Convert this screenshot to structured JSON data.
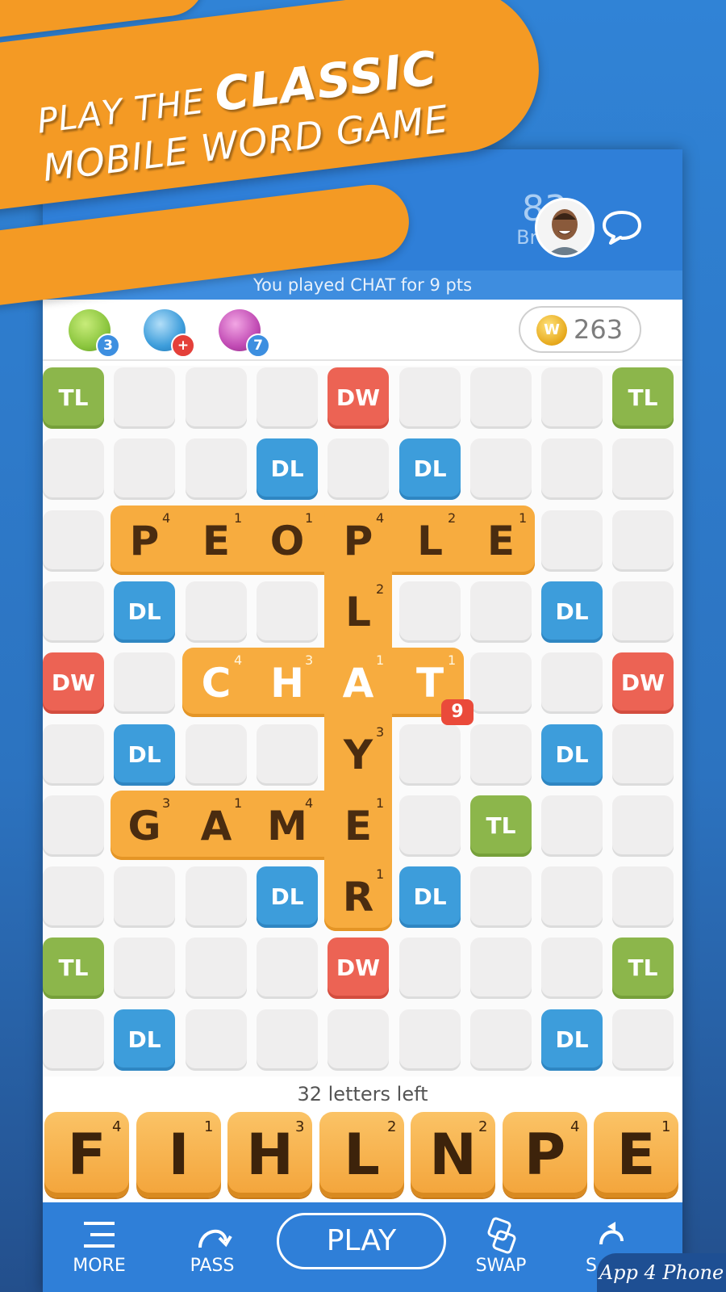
{
  "banner": {
    "line1_prefix": "PLAY THE",
    "line1_emphasis": "CLASSIC",
    "line2": "MOBILE WORD GAME"
  },
  "opponent": {
    "score": "83",
    "name": "Brian"
  },
  "status": "You played CHAT for 9 pts",
  "powerups": [
    {
      "icon": "swoosh-icon",
      "count": "3",
      "color": "#8cc63f",
      "badge_color": "#3d8fe0"
    },
    {
      "icon": "hindsight-icon",
      "count": "+",
      "color": "#3d9ddb",
      "badge_color": "#e4403a"
    },
    {
      "icon": "tile-swap-icon",
      "count": "7",
      "color": "#c14bb4",
      "badge_color": "#3d8fe0"
    }
  ],
  "coins": "263",
  "coin_symbol": "W",
  "board": {
    "bonus_cells": [
      {
        "r": 0,
        "c": 0,
        "type": "tl",
        "label": "TL"
      },
      {
        "r": 0,
        "c": 4,
        "type": "dw",
        "label": "DW"
      },
      {
        "r": 0,
        "c": 8,
        "type": "tl",
        "label": "TL"
      },
      {
        "r": 1,
        "c": 3,
        "type": "dl",
        "label": "DL"
      },
      {
        "r": 1,
        "c": 5,
        "type": "dl",
        "label": "DL"
      },
      {
        "r": 3,
        "c": 1,
        "type": "dl",
        "label": "DL"
      },
      {
        "r": 3,
        "c": 7,
        "type": "dl",
        "label": "DL"
      },
      {
        "r": 4,
        "c": 0,
        "type": "dw",
        "label": "DW"
      },
      {
        "r": 4,
        "c": 8,
        "type": "dw",
        "label": "DW"
      },
      {
        "r": 5,
        "c": 1,
        "type": "dl",
        "label": "DL"
      },
      {
        "r": 5,
        "c": 7,
        "type": "dl",
        "label": "DL"
      },
      {
        "r": 6,
        "c": 6,
        "type": "tl",
        "label": "TL"
      },
      {
        "r": 7,
        "c": 3,
        "type": "dl",
        "label": "DL"
      },
      {
        "r": 7,
        "c": 5,
        "type": "dl",
        "label": "DL"
      },
      {
        "r": 8,
        "c": 0,
        "type": "tl",
        "label": "TL"
      },
      {
        "r": 8,
        "c": 4,
        "type": "dw",
        "label": "DW"
      },
      {
        "r": 8,
        "c": 8,
        "type": "tl",
        "label": "TL"
      },
      {
        "r": 9,
        "c": 1,
        "type": "dl",
        "label": "DL"
      },
      {
        "r": 9,
        "c": 7,
        "type": "dl",
        "label": "DL"
      }
    ],
    "tiles": [
      {
        "r": 2,
        "c": 1,
        "letter": "P",
        "points": "4"
      },
      {
        "r": 2,
        "c": 2,
        "letter": "E",
        "points": "1"
      },
      {
        "r": 2,
        "c": 3,
        "letter": "O",
        "points": "1"
      },
      {
        "r": 2,
        "c": 4,
        "letter": "P",
        "points": "4"
      },
      {
        "r": 2,
        "c": 5,
        "letter": "L",
        "points": "2"
      },
      {
        "r": 2,
        "c": 6,
        "letter": "E",
        "points": "1"
      },
      {
        "r": 3,
        "c": 4,
        "letter": "L",
        "points": "2"
      },
      {
        "r": 4,
        "c": 2,
        "letter": "C",
        "points": "4",
        "highlight": true
      },
      {
        "r": 4,
        "c": 3,
        "letter": "H",
        "points": "3",
        "highlight": true
      },
      {
        "r": 4,
        "c": 4,
        "letter": "A",
        "points": "1",
        "highlight": true
      },
      {
        "r": 4,
        "c": 5,
        "letter": "T",
        "points": "1",
        "highlight": true
      },
      {
        "r": 5,
        "c": 4,
        "letter": "Y",
        "points": "3"
      },
      {
        "r": 6,
        "c": 1,
        "letter": "G",
        "points": "3"
      },
      {
        "r": 6,
        "c": 2,
        "letter": "A",
        "points": "1"
      },
      {
        "r": 6,
        "c": 3,
        "letter": "M",
        "points": "4"
      },
      {
        "r": 6,
        "c": 4,
        "letter": "E",
        "points": "1"
      },
      {
        "r": 7,
        "c": 4,
        "letter": "R",
        "points": "1"
      }
    ],
    "last_play_score": "9"
  },
  "letters_left": "32 letters left",
  "rack": [
    {
      "letter": "F",
      "points": "4"
    },
    {
      "letter": "I",
      "points": "1"
    },
    {
      "letter": "H",
      "points": "3"
    },
    {
      "letter": "L",
      "points": "2"
    },
    {
      "letter": "N",
      "points": "2"
    },
    {
      "letter": "P",
      "points": "4"
    },
    {
      "letter": "E",
      "points": "1"
    }
  ],
  "nav": {
    "more": "MORE",
    "pass": "PASS",
    "play": "PLAY",
    "swap": "SWAP",
    "shuffle": "S"
  },
  "watermark": "App 4 Phone"
}
